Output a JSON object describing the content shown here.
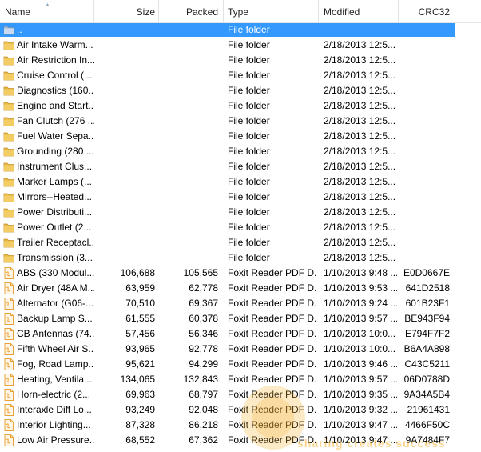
{
  "columns": {
    "name": "Name",
    "size": "Size",
    "packed": "Packed",
    "type": "Type",
    "modified": "Modified",
    "crc": "CRC32"
  },
  "rows": [
    {
      "name": "..",
      "size": "",
      "packed": "",
      "type": "File folder",
      "modified": "",
      "crc": "",
      "icon": "parent-folder-icon",
      "selected": true
    },
    {
      "name": "Air Intake Warm...",
      "size": "",
      "packed": "",
      "type": "File folder",
      "modified": "2/18/2013 12:5...",
      "crc": "",
      "icon": "folder-icon"
    },
    {
      "name": "Air Restriction In...",
      "size": "",
      "packed": "",
      "type": "File folder",
      "modified": "2/18/2013 12:5...",
      "crc": "",
      "icon": "folder-icon"
    },
    {
      "name": "Cruise Control (...",
      "size": "",
      "packed": "",
      "type": "File folder",
      "modified": "2/18/2013 12:5...",
      "crc": "",
      "icon": "folder-icon"
    },
    {
      "name": "Diagnostics (160...",
      "size": "",
      "packed": "",
      "type": "File folder",
      "modified": "2/18/2013 12:5...",
      "crc": "",
      "icon": "folder-icon"
    },
    {
      "name": "Engine and Start...",
      "size": "",
      "packed": "",
      "type": "File folder",
      "modified": "2/18/2013 12:5...",
      "crc": "",
      "icon": "folder-icon"
    },
    {
      "name": "Fan Clutch (276 ...",
      "size": "",
      "packed": "",
      "type": "File folder",
      "modified": "2/18/2013 12:5...",
      "crc": "",
      "icon": "folder-icon"
    },
    {
      "name": "Fuel Water Sepa...",
      "size": "",
      "packed": "",
      "type": "File folder",
      "modified": "2/18/2013 12:5...",
      "crc": "",
      "icon": "folder-icon"
    },
    {
      "name": "Grounding (280 ...",
      "size": "",
      "packed": "",
      "type": "File folder",
      "modified": "2/18/2013 12:5...",
      "crc": "",
      "icon": "folder-icon"
    },
    {
      "name": "Instrument Clus...",
      "size": "",
      "packed": "",
      "type": "File folder",
      "modified": "2/18/2013 12:5...",
      "crc": "",
      "icon": "folder-icon"
    },
    {
      "name": "Marker Lamps (...",
      "size": "",
      "packed": "",
      "type": "File folder",
      "modified": "2/18/2013 12:5...",
      "crc": "",
      "icon": "folder-icon"
    },
    {
      "name": "Mirrors--Heated...",
      "size": "",
      "packed": "",
      "type": "File folder",
      "modified": "2/18/2013 12:5...",
      "crc": "",
      "icon": "folder-icon"
    },
    {
      "name": "Power Distributi...",
      "size": "",
      "packed": "",
      "type": "File folder",
      "modified": "2/18/2013 12:5...",
      "crc": "",
      "icon": "folder-icon"
    },
    {
      "name": "Power Outlet (2...",
      "size": "",
      "packed": "",
      "type": "File folder",
      "modified": "2/18/2013 12:5...",
      "crc": "",
      "icon": "folder-icon"
    },
    {
      "name": "Trailer Receptacl...",
      "size": "",
      "packed": "",
      "type": "File folder",
      "modified": "2/18/2013 12:5...",
      "crc": "",
      "icon": "folder-icon"
    },
    {
      "name": "Transmission (3...",
      "size": "",
      "packed": "",
      "type": "File folder",
      "modified": "2/18/2013 12:5...",
      "crc": "",
      "icon": "folder-icon"
    },
    {
      "name": "ABS (330 Modul...",
      "size": "106,688",
      "packed": "105,565",
      "type": "Foxit Reader PDF D...",
      "modified": "1/10/2013 9:48 ...",
      "crc": "E0D0667E",
      "icon": "pdf-file-icon"
    },
    {
      "name": "Air Dryer (48A M...",
      "size": "63,959",
      "packed": "62,778",
      "type": "Foxit Reader PDF D...",
      "modified": "1/10/2013 9:53 ...",
      "crc": "641D2518",
      "icon": "pdf-file-icon"
    },
    {
      "name": "Alternator (G06-...",
      "size": "70,510",
      "packed": "69,367",
      "type": "Foxit Reader PDF D...",
      "modified": "1/10/2013 9:24 ...",
      "crc": "601B23F1",
      "icon": "pdf-file-icon"
    },
    {
      "name": "Backup Lamp S...",
      "size": "61,555",
      "packed": "60,378",
      "type": "Foxit Reader PDF D...",
      "modified": "1/10/2013 9:57 ...",
      "crc": "BE943F94",
      "icon": "pdf-file-icon"
    },
    {
      "name": "CB Antennas (74...",
      "size": "57,456",
      "packed": "56,346",
      "type": "Foxit Reader PDF D...",
      "modified": "1/10/2013 10:0...",
      "crc": "E794F7F2",
      "icon": "pdf-file-icon"
    },
    {
      "name": "Fifth Wheel Air S...",
      "size": "93,965",
      "packed": "92,778",
      "type": "Foxit Reader PDF D...",
      "modified": "1/10/2013 10:0...",
      "crc": "B6A4A898",
      "icon": "pdf-file-icon"
    },
    {
      "name": "Fog, Road Lamp...",
      "size": "95,621",
      "packed": "94,299",
      "type": "Foxit Reader PDF D...",
      "modified": "1/10/2013 9:46 ...",
      "crc": "C43C5211",
      "icon": "pdf-file-icon"
    },
    {
      "name": "Heating, Ventila...",
      "size": "134,065",
      "packed": "132,843",
      "type": "Foxit Reader PDF D...",
      "modified": "1/10/2013 9:57 ...",
      "crc": "06D0788D",
      "icon": "pdf-file-icon"
    },
    {
      "name": "Horn-electric (2...",
      "size": "69,963",
      "packed": "68,797",
      "type": "Foxit Reader PDF D...",
      "modified": "1/10/2013 9:35 ...",
      "crc": "9A34A5B4",
      "icon": "pdf-file-icon"
    },
    {
      "name": "Interaxle Diff Lo...",
      "size": "93,249",
      "packed": "92,048",
      "type": "Foxit Reader PDF D...",
      "modified": "1/10/2013 9:32 ...",
      "crc": "21961431",
      "icon": "pdf-file-icon"
    },
    {
      "name": "Interior Lighting...",
      "size": "87,328",
      "packed": "86,218",
      "type": "Foxit Reader PDF D...",
      "modified": "1/10/2013 9:47 ...",
      "crc": "4466F50C",
      "icon": "pdf-file-icon"
    },
    {
      "name": "Low Air Pressure...",
      "size": "68,552",
      "packed": "67,362",
      "type": "Foxit Reader PDF D...",
      "modified": "1/10/2013 9:47 ...",
      "crc": "9A7484F7",
      "icon": "pdf-file-icon"
    }
  ],
  "watermark": {
    "text": "sharing creates success",
    "color": "#f5b335"
  },
  "colors": {
    "selection": "#3399ff",
    "folder": "#e8b94a",
    "pdf_icon": "#e8a23a"
  }
}
